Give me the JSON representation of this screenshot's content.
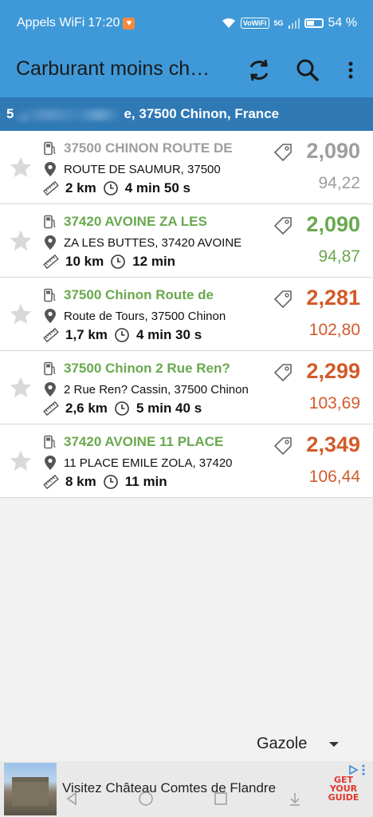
{
  "status_bar": {
    "carrier": "Appels WiFi",
    "time": "17:20",
    "vowifi": "VoWiFi",
    "network": "5G",
    "battery": "54 %"
  },
  "app_bar": {
    "title": "Carburant moins ch…",
    "refresh_icon": "refresh-icon",
    "search_icon": "search-icon",
    "menu_icon": "more-vert-icon"
  },
  "address": {
    "prefix": "5",
    "obscured_fragment": "l:ll",
    "suffix": "e, 37500 Chinon, France"
  },
  "stations": [
    {
      "name": "37500 CHINON ROUTE DE",
      "address": "ROUTE DE SAUMUR, 37500",
      "distance": "2 km",
      "duration": "4 min 50 s",
      "price": "2,090",
      "total": "94,22",
      "name_color": "#9e9e9e",
      "price_color": "#9e9e9e",
      "total_color": "#9e9e9e"
    },
    {
      "name": "37420 AVOINE ZA LES",
      "address": "ZA LES BUTTES, 37420 AVOINE",
      "distance": "10 km",
      "duration": "12 min",
      "price": "2,090",
      "total": "94,87",
      "name_color": "#6aa84f",
      "price_color": "#6aa84f",
      "total_color": "#6aa84f"
    },
    {
      "name": "37500 Chinon Route de",
      "address": "Route de Tours, 37500 Chinon",
      "distance": "1,7 km",
      "duration": "4 min 30 s",
      "price": "2,281",
      "total": "102,80",
      "name_color": "#6aa84f",
      "price_color": "#d35b2a",
      "total_color": "#d35b2a"
    },
    {
      "name": "37500 Chinon 2 Rue Ren?",
      "address": "2 Rue Ren? Cassin, 37500 Chinon",
      "distance": "2,6 km",
      "duration": "5 min 40 s",
      "price": "2,299",
      "total": "103,69",
      "name_color": "#6aa84f",
      "price_color": "#d35b2a",
      "total_color": "#d35b2a"
    },
    {
      "name": "37420 AVOINE 11 PLACE",
      "address": "11 PLACE EMILE ZOLA, 37420",
      "distance": "8 km",
      "duration": "11 min",
      "price": "2,349",
      "total": "106,44",
      "name_color": "#6aa84f",
      "price_color": "#d35b2a",
      "total_color": "#d35b2a"
    }
  ],
  "fuel_selector": {
    "selected": "Gazole"
  },
  "ad": {
    "text": "Visitez Château Comtes de Flandre",
    "logo_line1": "GET",
    "logo_line2": "YOUR",
    "logo_line3": "GUIDE"
  },
  "colors": {
    "app_bar": "#3f99d8",
    "address_bar": "#2f79b5",
    "green": "#6aa84f",
    "orange": "#d35b2a",
    "grey": "#9e9e9e"
  }
}
